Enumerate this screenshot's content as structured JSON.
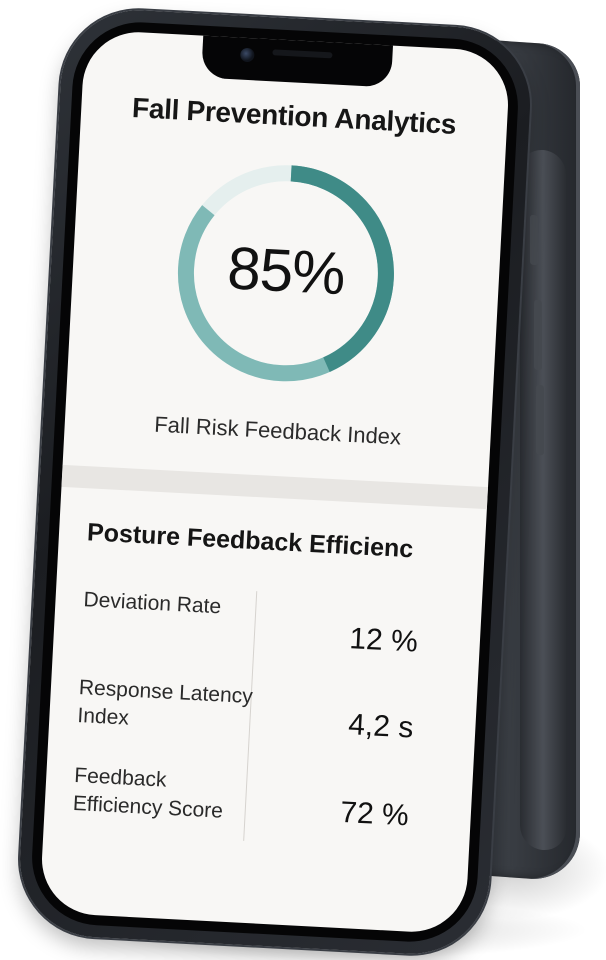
{
  "app": {
    "title": "Fall Prevention Analytics"
  },
  "risk_index": {
    "value_text": "85%",
    "fraction": 0.85,
    "label": "Fall Risk Feedback Index",
    "ring_color_light": "#7fb9b6",
    "ring_color_dark": "#3f8b87"
  },
  "posture_section": {
    "title": "Posture Feedback Efficienc",
    "metrics": [
      {
        "label": "Deviation Rate",
        "value": "12 %"
      },
      {
        "label": "Response Latency Index",
        "value": "4,2 s"
      },
      {
        "label": "Feedback Efficiency Score",
        "value": "72 %"
      }
    ]
  },
  "colors": {
    "screen_bg": "#f8f7f5",
    "phone_body": "#2e3238",
    "text_primary": "#151515"
  }
}
